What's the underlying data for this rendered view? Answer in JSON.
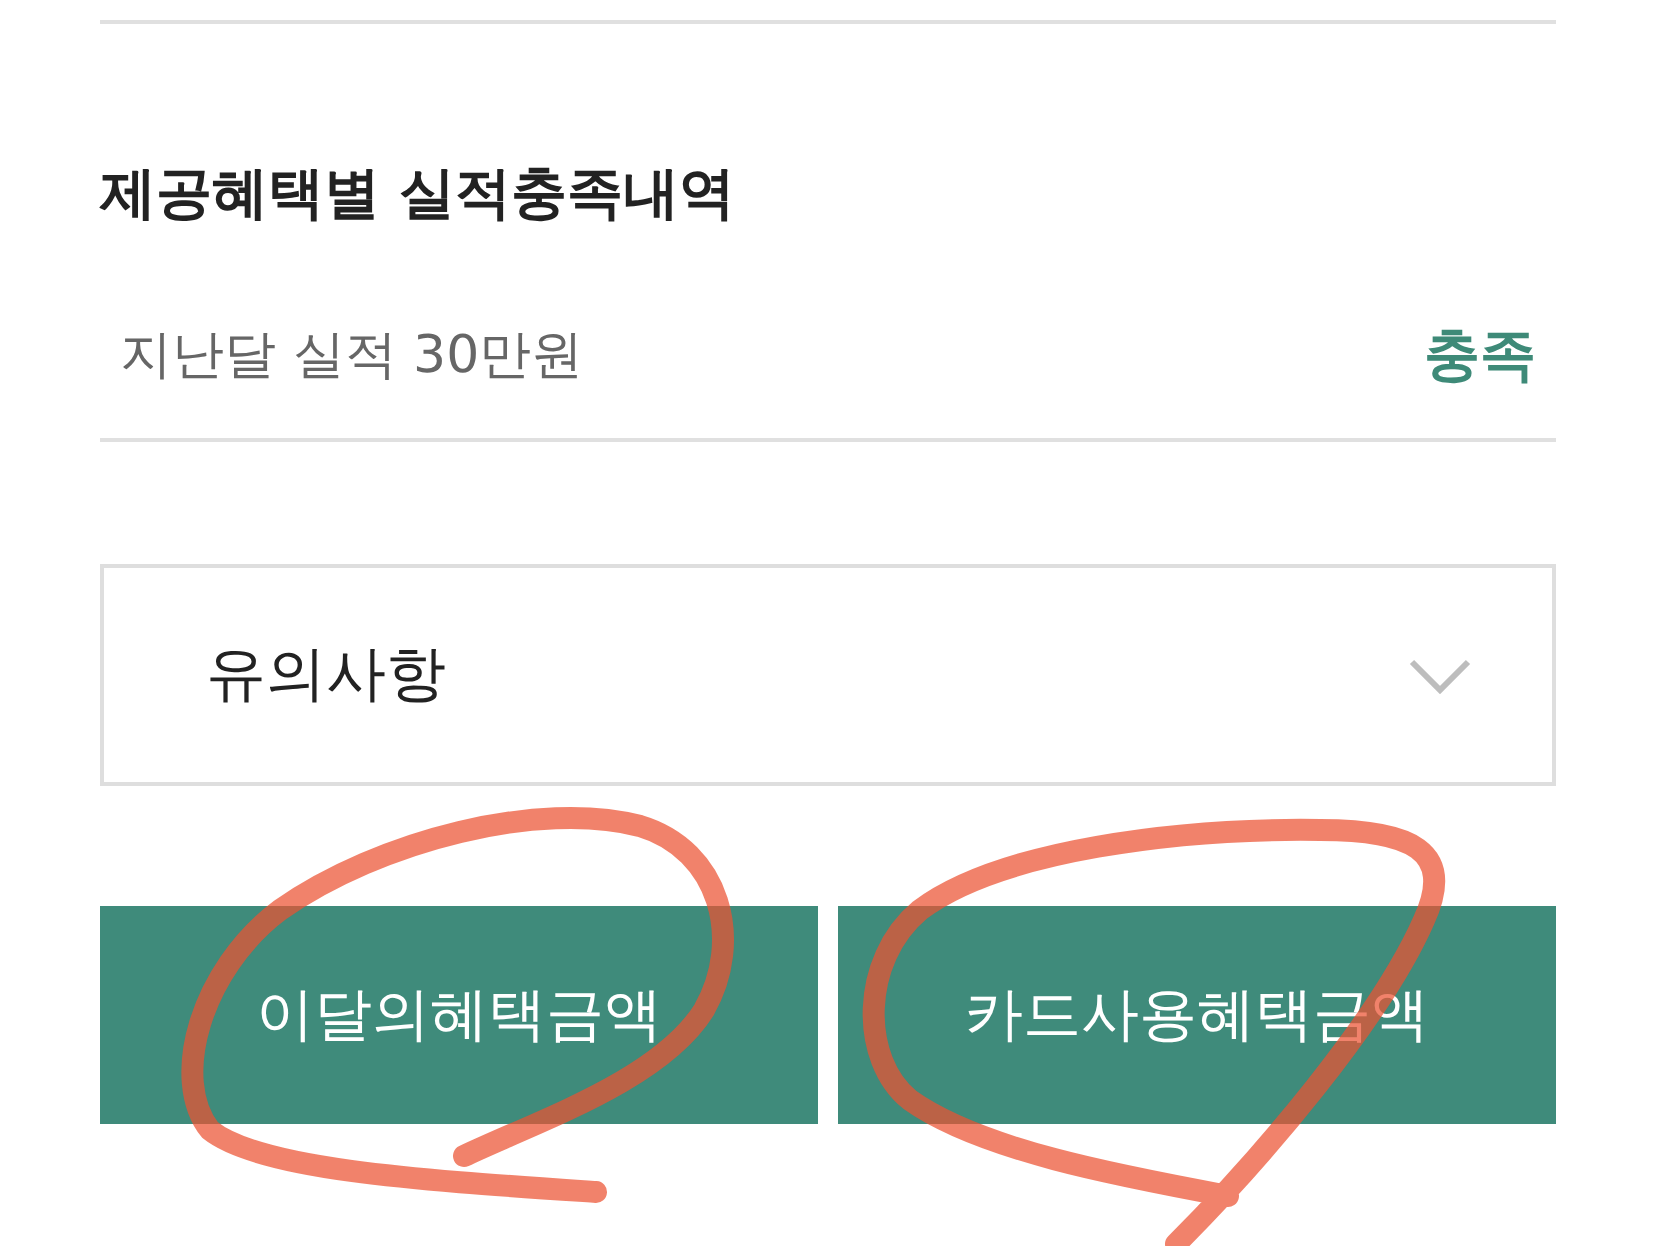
{
  "section": {
    "title": "제공혜택별 실적충족내역",
    "rows": [
      {
        "label": "지난달 실적 30만원",
        "status": "충족"
      }
    ]
  },
  "accordion": {
    "title": "유의사항",
    "expanded": false
  },
  "buttons": [
    {
      "label": "이달의혜택금액"
    },
    {
      "label": "카드사용혜택금액"
    }
  ]
}
